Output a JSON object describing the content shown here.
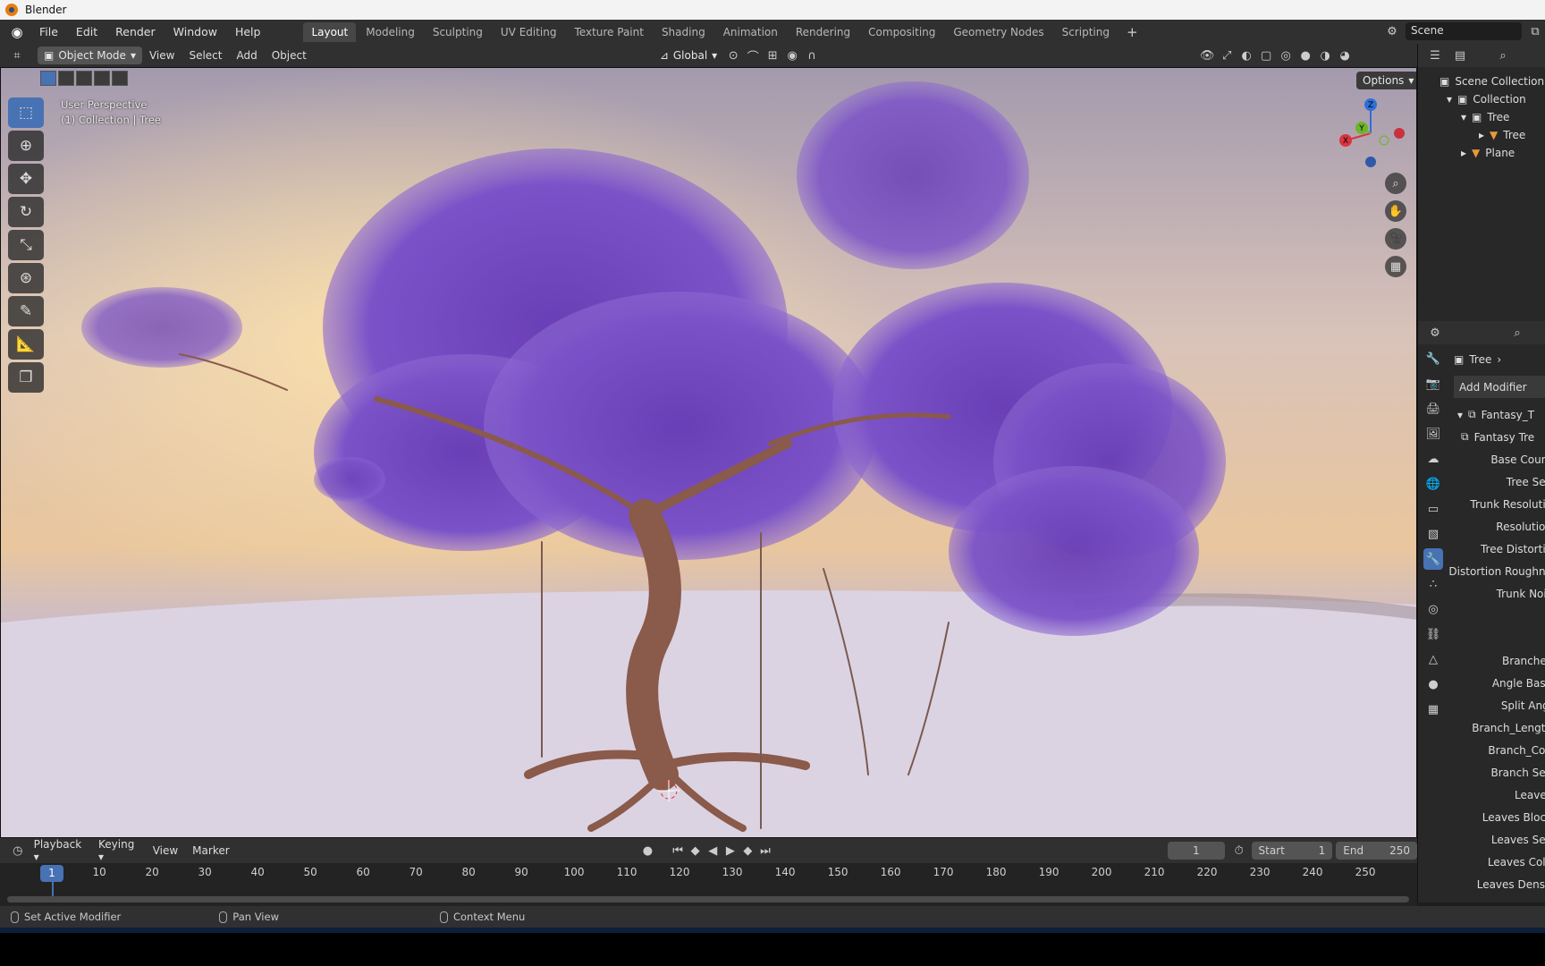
{
  "window": {
    "title": "Blender"
  },
  "menu": [
    "File",
    "Edit",
    "Render",
    "Window",
    "Help"
  ],
  "workspaces": [
    "Layout",
    "Modeling",
    "Sculpting",
    "UV Editing",
    "Texture Paint",
    "Shading",
    "Animation",
    "Rendering",
    "Compositing",
    "Geometry Nodes",
    "Scripting"
  ],
  "active_workspace": "Layout",
  "scene": {
    "name": "Scene"
  },
  "viewport_header": {
    "mode": "Object Mode",
    "view": "View",
    "select": "Select",
    "add": "Add",
    "object": "Object",
    "transform": "Global"
  },
  "viewport": {
    "perspective": "User Perspective",
    "collection_label": "(1) Collection | Tree",
    "options": "Options"
  },
  "gizmo": {
    "x": "X",
    "y": "Y",
    "z": "Z"
  },
  "outliner": {
    "rows": [
      "Scene Collection",
      "Collection",
      "Tree",
      "Tree",
      "Plane"
    ]
  },
  "properties": {
    "object": "Tree",
    "add_modifier": "Add Modifier",
    "modifier_name": "Fantasy_T",
    "nodegroup": "Fantasy Tre",
    "fields": [
      "Base Count",
      "Tree See",
      "Trunk Resolutio",
      "Resolution",
      "Tree Distortio",
      "Distortion Roughne",
      "Trunk Nois",
      "",
      "",
      "Branches",
      "Angle Base",
      "Split Angl",
      "Branch_Length",
      "Branch_Cou",
      "Branch See",
      "Leaves",
      "Leaves Block",
      "Leaves See",
      "Leaves Colo",
      "Leaves Densit"
    ]
  },
  "timeline": {
    "playback": "Playback",
    "keying": "Keying",
    "view": "View",
    "marker": "Marker",
    "current_frame": "1",
    "start_label": "Start",
    "start": "1",
    "end_label": "End",
    "end": "250",
    "ticks": [
      "1",
      "10",
      "20",
      "30",
      "40",
      "50",
      "60",
      "70",
      "80",
      "90",
      "100",
      "110",
      "120",
      "130",
      "140",
      "150",
      "160",
      "170",
      "180",
      "190",
      "200",
      "210",
      "220",
      "230",
      "240",
      "250"
    ]
  },
  "status": {
    "left": "Set Active Modifier",
    "middle": "Pan View",
    "right": "Context Menu"
  },
  "colors": {
    "accent": "#4772b3",
    "foliage": "#7a4fc4",
    "sky_top": "#c9c3d4",
    "sky_glow": "#f5c37a",
    "ground": "#d9d0e0"
  }
}
